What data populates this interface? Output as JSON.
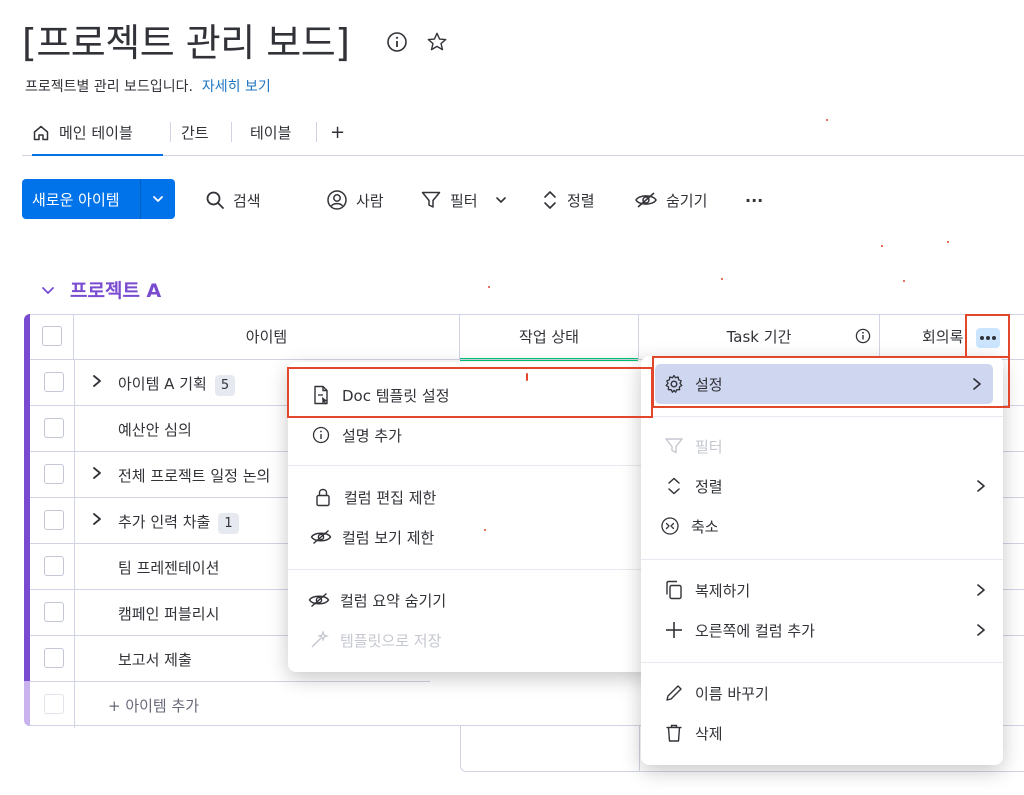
{
  "board": {
    "title": "[프로젝트 관리 보드]",
    "description": "프로젝트별 관리 보드입니다.",
    "see_more": "자세히 보기"
  },
  "tabs": [
    {
      "label": "메인 테이블",
      "icon": "home-icon",
      "active": true
    },
    {
      "label": "간트"
    },
    {
      "label": "테이블"
    },
    {
      "label": "+"
    }
  ],
  "toolbar": {
    "new_item": "새로운 아이템",
    "search": "검색",
    "person": "사람",
    "filter": "필터",
    "sort": "정렬",
    "hide": "숨기기",
    "more": "···"
  },
  "group": {
    "title": "프로젝트 A",
    "color": "#784bd1",
    "columns": {
      "item": "아이템",
      "status": "작업 상태",
      "timeline": "Task 기간",
      "meeting": "회의록"
    },
    "rows": [
      {
        "name": "아이템 A 기획",
        "count": "5",
        "expandable": true
      },
      {
        "name": "예산안 심의",
        "count": "",
        "expandable": false
      },
      {
        "name": "전체 프로젝트 일정 논의",
        "count": "",
        "expandable": true
      },
      {
        "name": "추가 인력 차출",
        "count": "1",
        "expandable": true
      },
      {
        "name": "팀 프레젠테이션",
        "count": "",
        "expandable": false
      },
      {
        "name": "캠페인 퍼블리시",
        "count": "",
        "expandable": false
      },
      {
        "name": "보고서 제출",
        "count": "",
        "expandable": false
      }
    ],
    "add_item": "+ 아이템 추가"
  },
  "submenu": {
    "doc_template": "Doc 템플릿 설정",
    "add_description": "설명 추가",
    "restrict_edit": "컬럼 편집 제한",
    "restrict_view": "컬럼 보기 제한",
    "hide_summary": "컬럼 요약 숨기기",
    "save_template": "템플릿으로 저장"
  },
  "column_menu": {
    "settings": "설정",
    "filter": "필터",
    "sort": "정렬",
    "collapse": "축소",
    "duplicate": "복제하기",
    "add_right": "오른쪽에 컬럼 추가",
    "rename": "이름 바꾸기",
    "delete": "삭제"
  },
  "colors": {
    "primary": "#0073ea",
    "group": "#784bd1",
    "status_green": "#00c875",
    "highlight": "#e2462b"
  }
}
